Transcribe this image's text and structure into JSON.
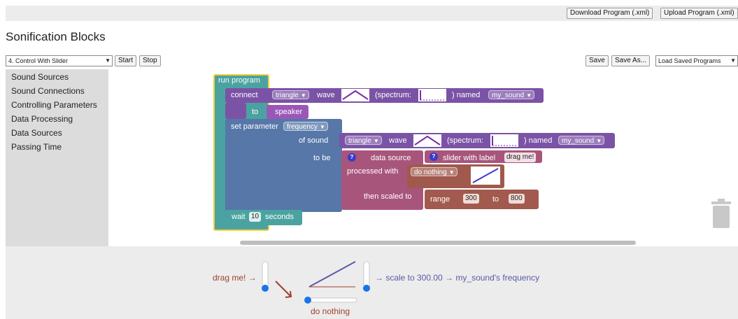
{
  "header": {
    "download_label": "Download Program (.xml)",
    "upload_label": "Upload Program (.xml)",
    "page_title": "Sonification Blocks"
  },
  "controls": {
    "example_select": "4. Control With Slider",
    "start_label": "Start",
    "stop_label": "Stop",
    "save_label": "Save",
    "save_as_label": "Save As...",
    "load_label": "Load Saved Programs"
  },
  "toolbox": {
    "items": [
      {
        "label": "Sound Sources"
      },
      {
        "label": "Sound Connections"
      },
      {
        "label": "Controlling Parameters"
      },
      {
        "label": "Data Processing"
      },
      {
        "label": "Data Sources"
      },
      {
        "label": "Passing Time"
      }
    ]
  },
  "blocks": {
    "run_program": "run program",
    "connect": {
      "label": "connect",
      "wave_type": "triangle",
      "wave_label": "wave",
      "spectrum_label": "(spectrum:",
      "named_label": ") named",
      "sound_name": "my_sound",
      "to_label": "to",
      "dest": "speaker"
    },
    "set_param": {
      "label": "set parameter",
      "param": "frequency",
      "of_sound_label": "of sound",
      "wave_type": "triangle",
      "wave_label": "wave",
      "spectrum_label": "(spectrum:",
      "named_label": ") named",
      "sound_name": "my_sound",
      "to_be_label": "to be"
    },
    "data_source": {
      "q": "?",
      "label": "data source",
      "slider_label": "slider with label",
      "slider_text": "drag me!",
      "processed_label": "processed with",
      "process_fn": "do nothing",
      "scaled_label": "then scaled to",
      "range_label": "range",
      "range_min": "300",
      "range_to": "to",
      "range_max": "800"
    },
    "wait": {
      "label": "wait",
      "value": "10",
      "unit": "seconds"
    }
  },
  "visualization": {
    "slider_label": "drag me! →",
    "process_label": "do nothing",
    "output_label": "→ scale to 300.00 → my_sound's frequency"
  },
  "colors": {
    "run_program": "#4aa3a0",
    "run_program_border": "#f2d035",
    "connect": "#7b53a6",
    "speaker": "#9b57b8",
    "set_param": "#5677a8",
    "data_source": "#a8557c",
    "processed": "#a0594c",
    "range": "#a15a4d",
    "wait": "#4aa3a0",
    "viz_red": "#a0412d",
    "viz_blue": "#5a5aa8",
    "slider_dot": "#1a73e8"
  }
}
